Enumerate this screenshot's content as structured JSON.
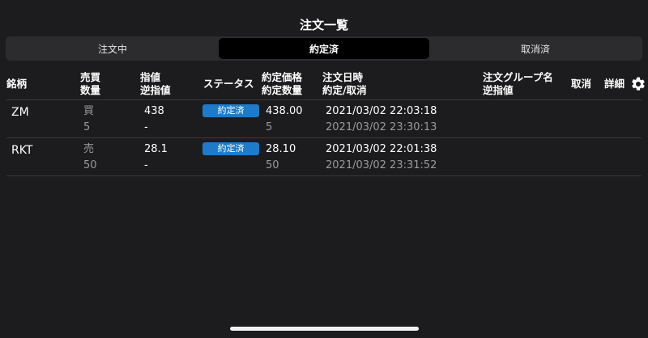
{
  "title": "注文一覧",
  "tabs": [
    {
      "label": "注文中",
      "active": false
    },
    {
      "label": "約定済",
      "active": true
    },
    {
      "label": "取消済",
      "active": false
    }
  ],
  "columns": {
    "symbol": "銘柄",
    "side": "売買",
    "qty": "数量",
    "limit": "指値",
    "stop": "逆指値",
    "status": "ステータス",
    "exec_price": "約定価格",
    "exec_qty": "約定数量",
    "order_time": "注文日時",
    "exec_cancel": "約定/取消",
    "group": "注文グループ名",
    "group_stop": "逆指値",
    "cancel": "取消",
    "detail": "詳細"
  },
  "rows": [
    {
      "symbol": "ZM",
      "side": "買",
      "qty": "5",
      "limit": "438",
      "stop": "-",
      "status": "約定済",
      "exec_price": "438.00",
      "exec_qty": "5",
      "order_time": "2021/03/02 22:03:18",
      "exec_time": "2021/03/02 23:30:13"
    },
    {
      "symbol": "RKT",
      "side": "売",
      "qty": "50",
      "limit": "28.1",
      "stop": "-",
      "status": "約定済",
      "exec_price": "28.10",
      "exec_qty": "50",
      "order_time": "2021/03/02 22:01:38",
      "exec_time": "2021/03/02 23:31:52"
    }
  ],
  "colors": {
    "background": "#1c1c1e",
    "segment_bg": "#2c2c2e",
    "segment_active": "#000000",
    "badge": "#1e7bc9",
    "secondary_text": "#9a9a9e",
    "divider": "#3a3a3c"
  },
  "icons": {
    "settings": "gear-icon"
  }
}
